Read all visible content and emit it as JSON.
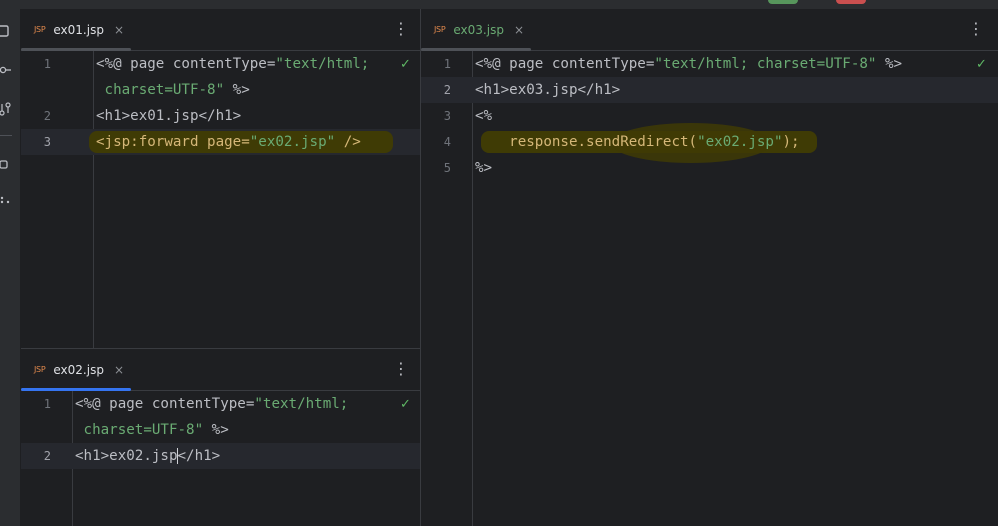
{
  "left_top": {
    "tab": {
      "type": "JSP",
      "name": "ex01.jsp",
      "close": "×"
    },
    "lines": [
      {
        "num": "1",
        "pre": "<%@ page contentType=",
        "str": "\"text/html;",
        "post": ""
      },
      {
        "num": "",
        "pre": " ",
        "str": "charset=UTF-8\"",
        "post": " %>"
      },
      {
        "num": "2",
        "pre": "<h1>ex01.jsp</h1>",
        "str": "",
        "post": ""
      },
      {
        "num": "3",
        "pre": "<jsp:forward page=",
        "str": "\"ex02.jsp\"",
        "post": " />"
      }
    ]
  },
  "left_bottom": {
    "tab": {
      "type": "JSP",
      "name": "ex02.jsp",
      "close": "×"
    },
    "lines": [
      {
        "num": "1",
        "pre": "<%@ page contentType=",
        "str": "\"text/html;",
        "post": ""
      },
      {
        "num": "",
        "pre": " ",
        "str": "charset=UTF-8\"",
        "post": " %>"
      },
      {
        "num": "2",
        "pre_a": "<h1>ex02.jsp",
        "pre_b": "</h1>"
      }
    ]
  },
  "right": {
    "tab": {
      "type": "JSP",
      "name": "ex03.jsp",
      "close": "×"
    },
    "lines": [
      {
        "num": "1",
        "pre": "<%@ page contentType=",
        "str": "\"text/html; charset=UTF-8\"",
        "post": " %>"
      },
      {
        "num": "2",
        "pre": "<h1>ex03.jsp</h1>",
        "str": "",
        "post": ""
      },
      {
        "num": "3",
        "pre": "<%",
        "str": "",
        "post": ""
      },
      {
        "num": "4",
        "pre": "    response.sendRedirect(",
        "str": "\"ex02.jsp\"",
        "post": ");"
      },
      {
        "num": "5",
        "pre": "%>",
        "str": "",
        "post": ""
      }
    ]
  },
  "icons": {
    "check": "✓",
    "kebab": "⋮"
  },
  "colors": {
    "accent": "#3574f0",
    "string": "#6aab73",
    "highlight": "#3f3b05"
  }
}
